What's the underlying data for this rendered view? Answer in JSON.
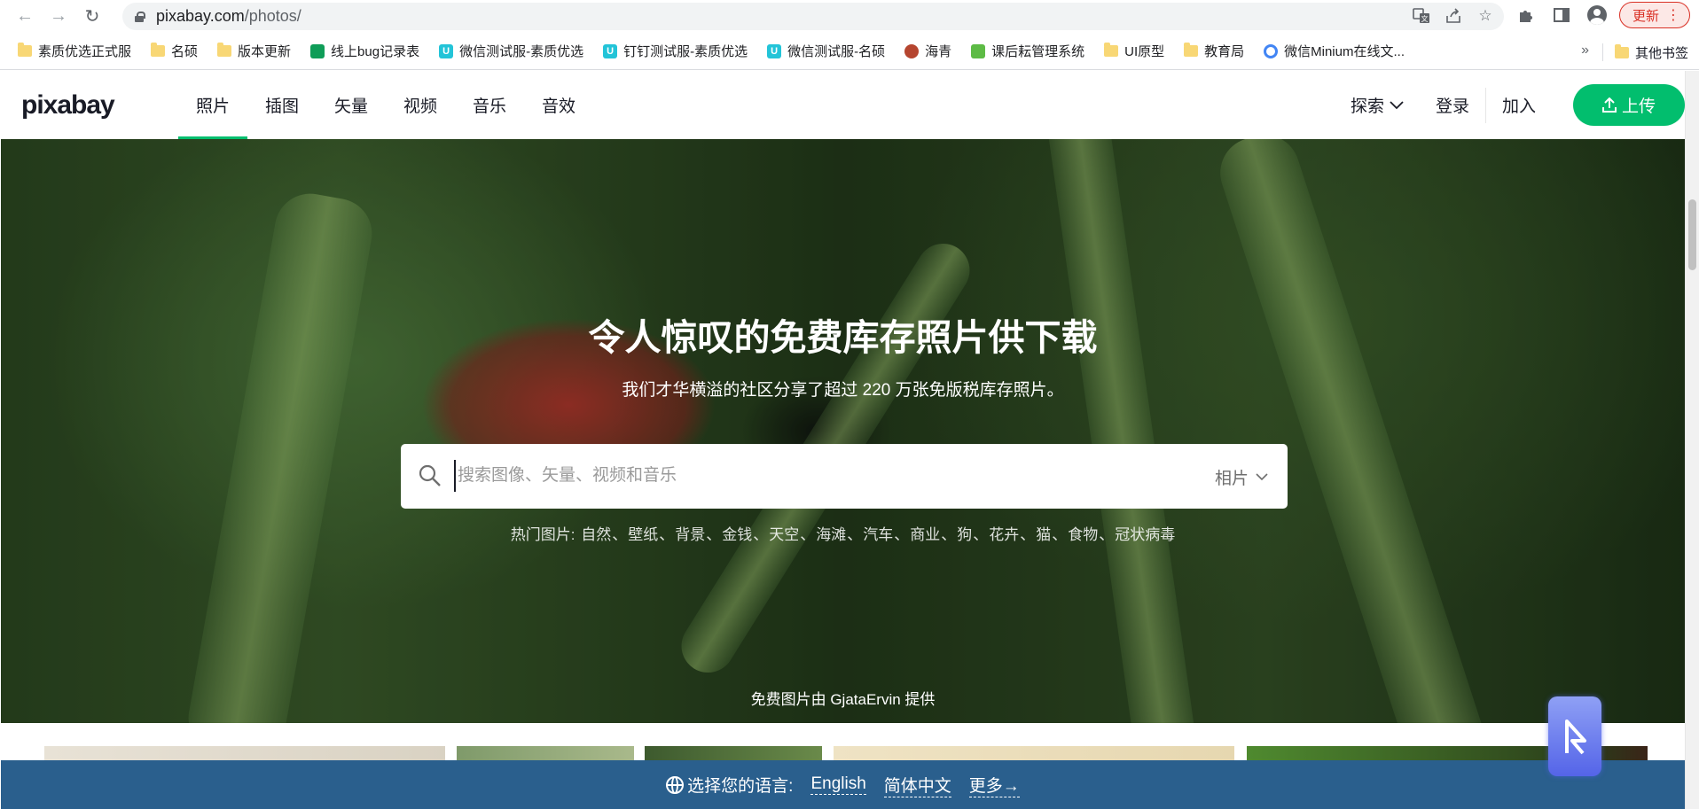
{
  "browser": {
    "url_host": "pixabay.com",
    "url_path": "/photos/",
    "update_label": "更新",
    "bookmarks": [
      {
        "label": "素质优选正式服",
        "icon": "folder-icon"
      },
      {
        "label": "名硕",
        "icon": "folder-icon"
      },
      {
        "label": "版本更新",
        "icon": "folder-icon"
      },
      {
        "label": "线上bug记录表",
        "icon": "sheet-icon"
      },
      {
        "label": "微信测试服-素质优选",
        "icon": "u-app-icon"
      },
      {
        "label": "钉钉测试服-素质优选",
        "icon": "u-app-icon"
      },
      {
        "label": "微信测试服-名硕",
        "icon": "u-app-icon"
      },
      {
        "label": "海青",
        "icon": "badge-icon"
      },
      {
        "label": "课后耘管理系统",
        "icon": "app-icon"
      },
      {
        "label": "UI原型",
        "icon": "folder-icon"
      },
      {
        "label": "教育局",
        "icon": "folder-icon"
      },
      {
        "label": "微信Minium在线文...",
        "icon": "ring-icon"
      }
    ],
    "more_bookmarks": "»",
    "other_bookmarks": "其他书签"
  },
  "site": {
    "logo": "pixabay",
    "tabs": [
      "照片",
      "插图",
      "矢量",
      "视频",
      "音乐",
      "音效"
    ],
    "active_tab": "照片",
    "explore": "探索",
    "login": "登录",
    "join": "加入",
    "upload": "上传"
  },
  "hero": {
    "title": "令人惊叹的免费库存照片供下载",
    "subtitle": "我们才华横溢的社区分享了超过 220 万张免版税库存照片。",
    "search_placeholder": "搜索图像、矢量、视频和音乐",
    "search_type": "相片",
    "hot_label": "热门图片:",
    "hot_items": [
      "自然",
      "壁纸",
      "背景",
      "金钱",
      "天空",
      "海滩",
      "汽车",
      "商业",
      "狗",
      "花卉",
      "猫",
      "食物",
      "冠状病毒"
    ],
    "credit": "免费图片由 GjataErvin 提供"
  },
  "language_bar": {
    "label": "选择您的语言:",
    "options": [
      "English",
      "简体中文",
      "更多→"
    ]
  },
  "colors": {
    "brand_green": "#02be6e",
    "lang_bar": "#2a5f8d",
    "update_red": "#d93025"
  }
}
